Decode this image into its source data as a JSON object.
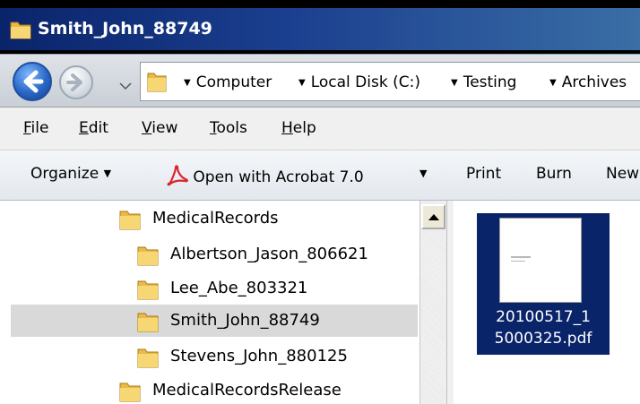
{
  "window": {
    "title": "Smith_John_88749"
  },
  "address_bar": {
    "breadcrumbs": [
      "Computer",
      "Local Disk (C:)",
      "Testing",
      "Archives"
    ]
  },
  "menu": {
    "items": [
      {
        "accel": "F",
        "rest": "ile"
      },
      {
        "accel": "E",
        "rest": "dit"
      },
      {
        "accel": "V",
        "rest": "iew"
      },
      {
        "accel": "T",
        "rest": "ools"
      },
      {
        "accel": "H",
        "rest": "elp"
      }
    ]
  },
  "command_bar": {
    "organize": "Organize",
    "open_with": "Open with Acrobat 7.0",
    "print": "Print",
    "burn": "Burn",
    "new": "New"
  },
  "tree": {
    "items": [
      {
        "label": "MedicalRecords",
        "level": 1,
        "selected": false
      },
      {
        "label": "Albertson_Jason_806621",
        "level": 2,
        "selected": false
      },
      {
        "label": "Lee_Abe_803321",
        "level": 2,
        "selected": false
      },
      {
        "label": "Smith_John_88749",
        "level": 2,
        "selected": true
      },
      {
        "label": "Stevens_John_880125",
        "level": 2,
        "selected": false
      },
      {
        "label": "MedicalRecordsRelease",
        "level": 1,
        "selected": false
      }
    ]
  },
  "files": [
    {
      "name_line1": "20100517_1",
      "name_line2": "5000325.pdf",
      "selected": true
    }
  ],
  "icons": {
    "folder": "folder-icon",
    "back": "back-arrow-icon",
    "forward": "forward-arrow-icon",
    "pdf": "acrobat-icon"
  },
  "colors": {
    "titlebar_start": "#0a246a",
    "selection": "#0a246a",
    "tree_selection": "#d9d9d9"
  }
}
